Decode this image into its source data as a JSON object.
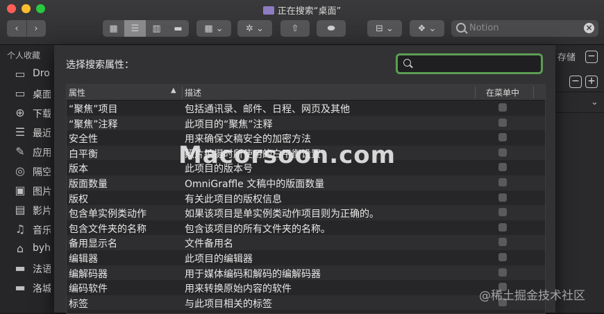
{
  "window": {
    "title": "正在搜索“桌面”"
  },
  "toolbar": {
    "search_placeholder": "Notion"
  },
  "sidebar": {
    "header": "个人收藏",
    "items": [
      {
        "icon": "cloud-icon",
        "glyph": "▭",
        "label": "Dro"
      },
      {
        "icon": "desktop-icon",
        "glyph": "▭",
        "label": "桌面"
      },
      {
        "icon": "download-icon",
        "glyph": "⊕",
        "label": "下载"
      },
      {
        "icon": "recents-icon",
        "glyph": "☰",
        "label": "最近"
      },
      {
        "icon": "applications-icon",
        "glyph": "✎",
        "label": "应用"
      },
      {
        "icon": "airdrop-icon",
        "glyph": "◎",
        "label": "隔空"
      },
      {
        "icon": "pictures-icon",
        "glyph": "▣",
        "label": "图片"
      },
      {
        "icon": "movies-icon",
        "glyph": "▤",
        "label": "影片"
      },
      {
        "icon": "music-icon",
        "glyph": "♫",
        "label": "音乐"
      },
      {
        "icon": "home-icon",
        "glyph": "⌂",
        "label": "byh"
      },
      {
        "icon": "folder-icon",
        "glyph": "▬",
        "label": "法语"
      },
      {
        "icon": "folder-icon-2",
        "glyph": "▬",
        "label": "洛城"
      }
    ]
  },
  "right_panel": {
    "save_label": "存储"
  },
  "sheet": {
    "title": "选择搜索属性：",
    "search_value": "",
    "columns": {
      "attribute": "属性",
      "description": "描述",
      "in_menu": "在菜单中"
    },
    "rows": [
      {
        "attr": "“聚焦”项目",
        "desc": "包括通讯录、邮件、日程、网页及其他"
      },
      {
        "attr": "“聚焦”注释",
        "desc": "此项目的“聚焦”注释"
      },
      {
        "attr": "安全性",
        "desc": "用来确保文稿安全的加密方法"
      },
      {
        "attr": "白平衡",
        "desc": "照片拍摄时所使用的白平衡设置"
      },
      {
        "attr": "版本",
        "desc": "此项目的版本号"
      },
      {
        "attr": "版面数量",
        "desc": "OmniGraffle 文稿中的版面数量"
      },
      {
        "attr": "版权",
        "desc": "有关此项目的版权信息"
      },
      {
        "attr": "包含单实例类动作",
        "desc": "如果该项目是单实例类动作项目则为正确的。"
      },
      {
        "attr": "包含文件夹的名称",
        "desc": "包含该项目的所有文件夹的名称。"
      },
      {
        "attr": "备用显示名",
        "desc": "文件备用名"
      },
      {
        "attr": "编辑器",
        "desc": "此项目的编辑器"
      },
      {
        "attr": "编解码器",
        "desc": "用于媒体编码和解码的编解码器"
      },
      {
        "attr": "编码软件",
        "desc": "用来转换原始内容的软件"
      },
      {
        "attr": "标签",
        "desc": "与此项目相关的标签"
      }
    ]
  },
  "watermarks": {
    "main": "Macorsoon.com",
    "corner": "@稀土掘金技术社区"
  },
  "colors": {
    "accent_focus": "#5c9e54",
    "sheet_bg": "#323234",
    "table_bg": "#262628"
  }
}
